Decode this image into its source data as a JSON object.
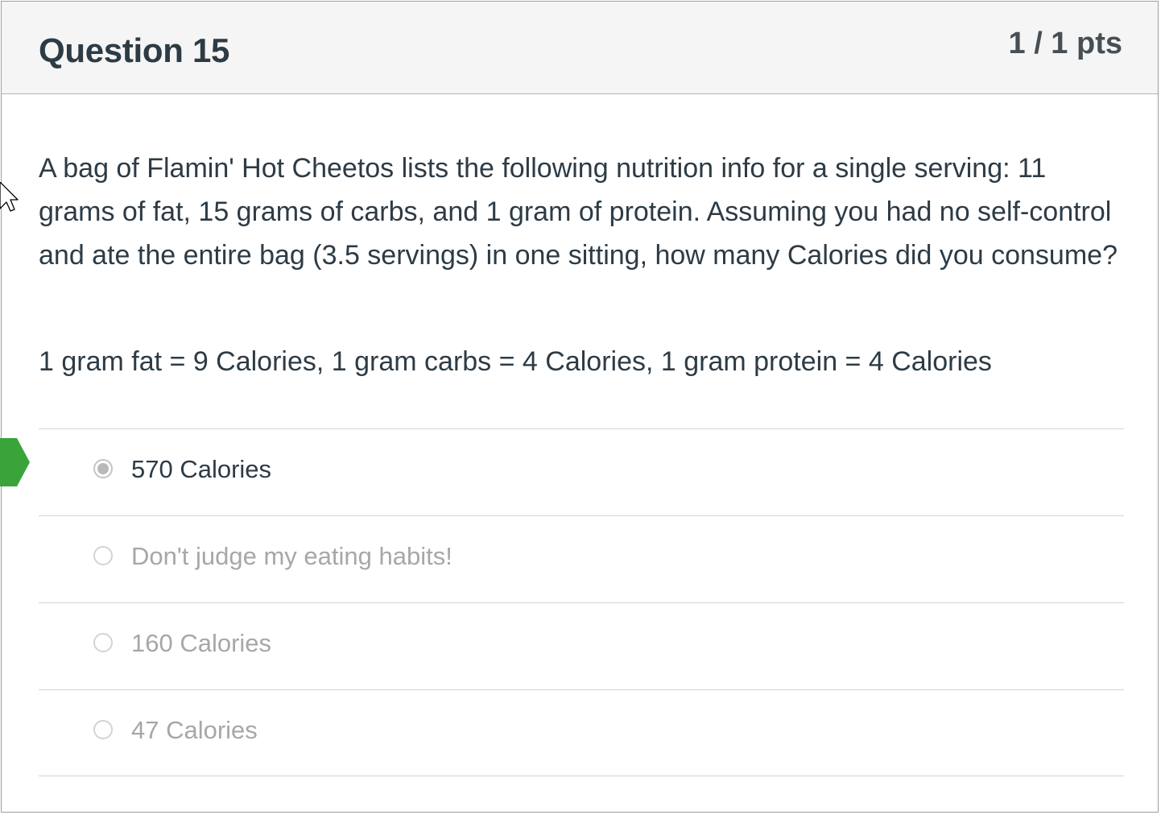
{
  "question": {
    "title": "Question 15",
    "points": "1 / 1 pts",
    "text": "A bag of Flamin' Hot Cheetos lists the following nutrition info for a single serving: 11 grams of fat, 15 grams of carbs, and 1 gram of protein.  Assuming you had no self-control and ate the entire bag (3.5 servings) in one sitting, how many Calories did you consume?",
    "conversion": "1 gram fat = 9 Calories,  1 gram carbs = 4 Calories, 1 gram protein = 4 Calories"
  },
  "answers": [
    {
      "label": "570 Calories",
      "selected": true
    },
    {
      "label": "Don't judge my eating habits!",
      "selected": false
    },
    {
      "label": "160 Calories",
      "selected": false
    },
    {
      "label": "47 Calories",
      "selected": false
    }
  ],
  "colors": {
    "correct_flag": "#3aa43a",
    "header_bg": "#f5f5f5",
    "text": "#2d3b45",
    "muted_text": "#a7a7a7"
  },
  "icons": {
    "correct_marker": "correct-answer-flag-icon",
    "cursor": "mouse-pointer-icon"
  }
}
